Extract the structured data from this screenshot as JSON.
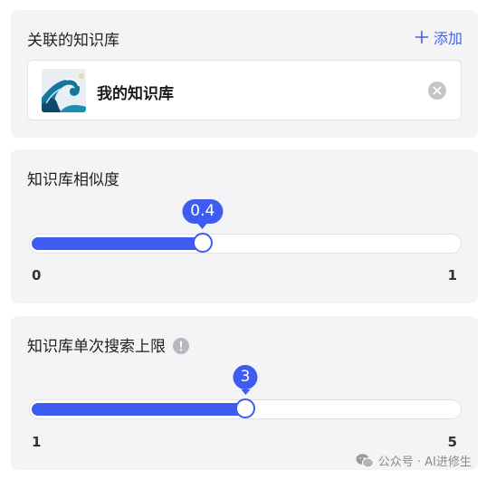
{
  "knowledge_base_card": {
    "title": "关联的知识库",
    "add_label": "添加",
    "item": {
      "name": "我的知识库",
      "thumbnail_icon": "wave-thumbnail"
    }
  },
  "similarity_card": {
    "title": "知识库相似度",
    "value": "0.4",
    "fraction": 0.4,
    "min_label": "0",
    "max_label": "1"
  },
  "search_limit_card": {
    "title": "知识库单次搜索上限",
    "value": "3",
    "fraction": 0.5,
    "min_label": "1",
    "max_label": "5"
  },
  "watermark": {
    "text": "公众号 · AI进修生"
  },
  "colors": {
    "accent": "#3e5cf0",
    "link": "#4463e3",
    "card_bg": "#f4f4f6"
  }
}
